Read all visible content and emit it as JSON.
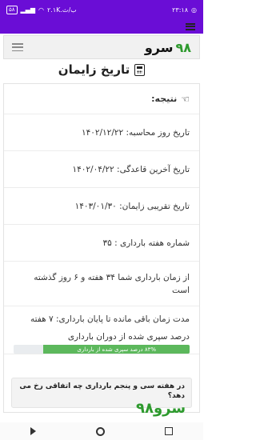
{
  "status_bar": {
    "time": "۲۳:۱۸",
    "network_speed": "۲.۱K.ب/ث",
    "battery": "۵۸"
  },
  "header": {
    "logo_text": "سرو",
    "logo_number": "۹۸"
  },
  "page": {
    "title": "تاریخ زایمان"
  },
  "result": {
    "heading": "نتیجه:",
    "calc_date": "تاریخ روز محاسبه: ۱۴۰۲/۱۲/۲۲",
    "last_period": "تاریخ آخرین قاعدگی: ۱۴۰۲/۰۴/۲۲",
    "due_date": "تاریخ تقریبی زایمان: ۱۴۰۳/۰۱/۳۰",
    "week_number": "شماره هفته بارداری : ۳۵",
    "elapsed": "از زمان بارداری شما ۳۴ هفته و ۶ روز گذشته است",
    "remaining": "مدت زمان باقی مانده تا پایان بارداری: ۷ هفته",
    "progress_label": "درصد سپری شده از دوران بارداری",
    "progress_text": "۸۳% درصد سپری شده از بارداری",
    "progress_percent": 83
  },
  "question": {
    "text": "در هفته سی و پنجم بارداری چه اتفاقی رخ می دهد؟"
  },
  "watermark": "سرو۹۸",
  "colors": {
    "accent_purple": "#6a0dd6",
    "progress_green": "#5cb85c",
    "logo_green": "#2e9a2e"
  }
}
